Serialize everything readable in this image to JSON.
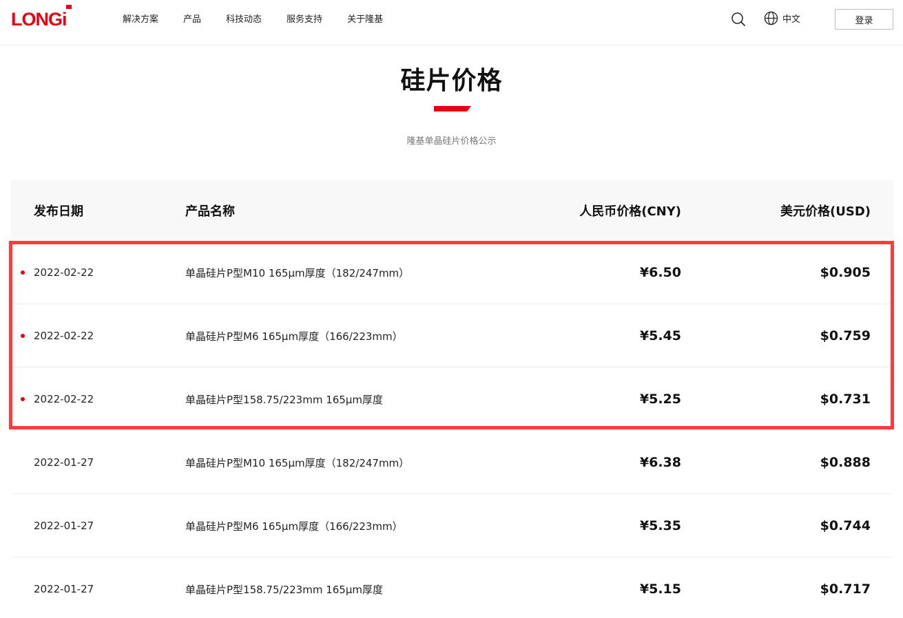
{
  "header": {
    "nav": [
      "解决方案",
      "产品",
      "科技动态",
      "服务支持",
      "关于隆基"
    ],
    "language": "中文",
    "login_label": "登录"
  },
  "page": {
    "title": "硅片价格",
    "subtitle": "隆基单晶硅片价格公示"
  },
  "table": {
    "headers": {
      "date": "发布日期",
      "name": "产品名称",
      "cny": "人民币价格(CNY)",
      "usd": "美元价格(USD)"
    },
    "rows": [
      {
        "date": "2022-02-22",
        "name": "单晶硅片P型M10 165μm厚度（182/247mm）",
        "cny": "¥6.50",
        "usd": "$0.905",
        "is_new": true
      },
      {
        "date": "2022-02-22",
        "name": "单晶硅片P型M6 165μm厚度（166/223mm）",
        "cny": "¥5.45",
        "usd": "$0.759",
        "is_new": true
      },
      {
        "date": "2022-02-22",
        "name": "单晶硅片P型158.75/223mm 165μm厚度",
        "cny": "¥5.25",
        "usd": "$0.731",
        "is_new": true
      },
      {
        "date": "2022-01-27",
        "name": "单晶硅片P型M10 165μm厚度（182/247mm）",
        "cny": "¥6.38",
        "usd": "$0.888",
        "is_new": false
      },
      {
        "date": "2022-01-27",
        "name": "单晶硅片P型M6 165μm厚度（166/223mm）",
        "cny": "¥5.35",
        "usd": "$0.744",
        "is_new": false
      },
      {
        "date": "2022-01-27",
        "name": "单晶硅片P型158.75/223mm 165μm厚度",
        "cny": "¥5.15",
        "usd": "$0.717",
        "is_new": false
      }
    ]
  },
  "colors": {
    "brand_red": "#e60012",
    "highlight": "#ff3b3b"
  }
}
